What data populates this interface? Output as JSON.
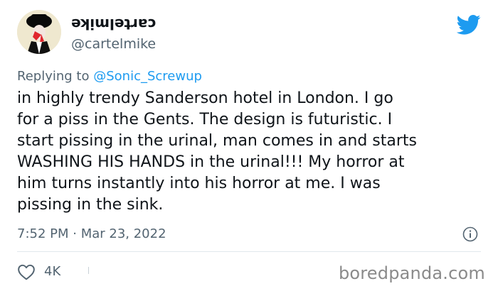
{
  "header": {
    "display_name": "cartelmike",
    "handle": "@cartelmike",
    "avatar_icon": "avatar-image",
    "platform_icon": "twitter-bird-icon"
  },
  "reply": {
    "prefix": "Replying to",
    "handle": "@Sonic_Screwup"
  },
  "tweet": {
    "lines": [
      "in highly trendy Sanderson hotel in London. I go",
      "for a piss in the Gents. The design is futuristic. I",
      "start pissing in the urinal, man comes in and starts",
      "WASHING HIS HANDS in the urinal!!! My horror at",
      "him turns instantly into his horror at me. I was",
      "pissing in the sink."
    ],
    "timestamp": "7:52 PM · Mar 23, 2022"
  },
  "actions": {
    "like_icon": "heart-icon",
    "like_count": "4K",
    "info_icon": "info-icon"
  },
  "watermark": "boredpanda.com",
  "colors": {
    "twitter_blue": "#1d9bf0",
    "secondary_text": "#536471",
    "primary_text": "#0f1419"
  }
}
